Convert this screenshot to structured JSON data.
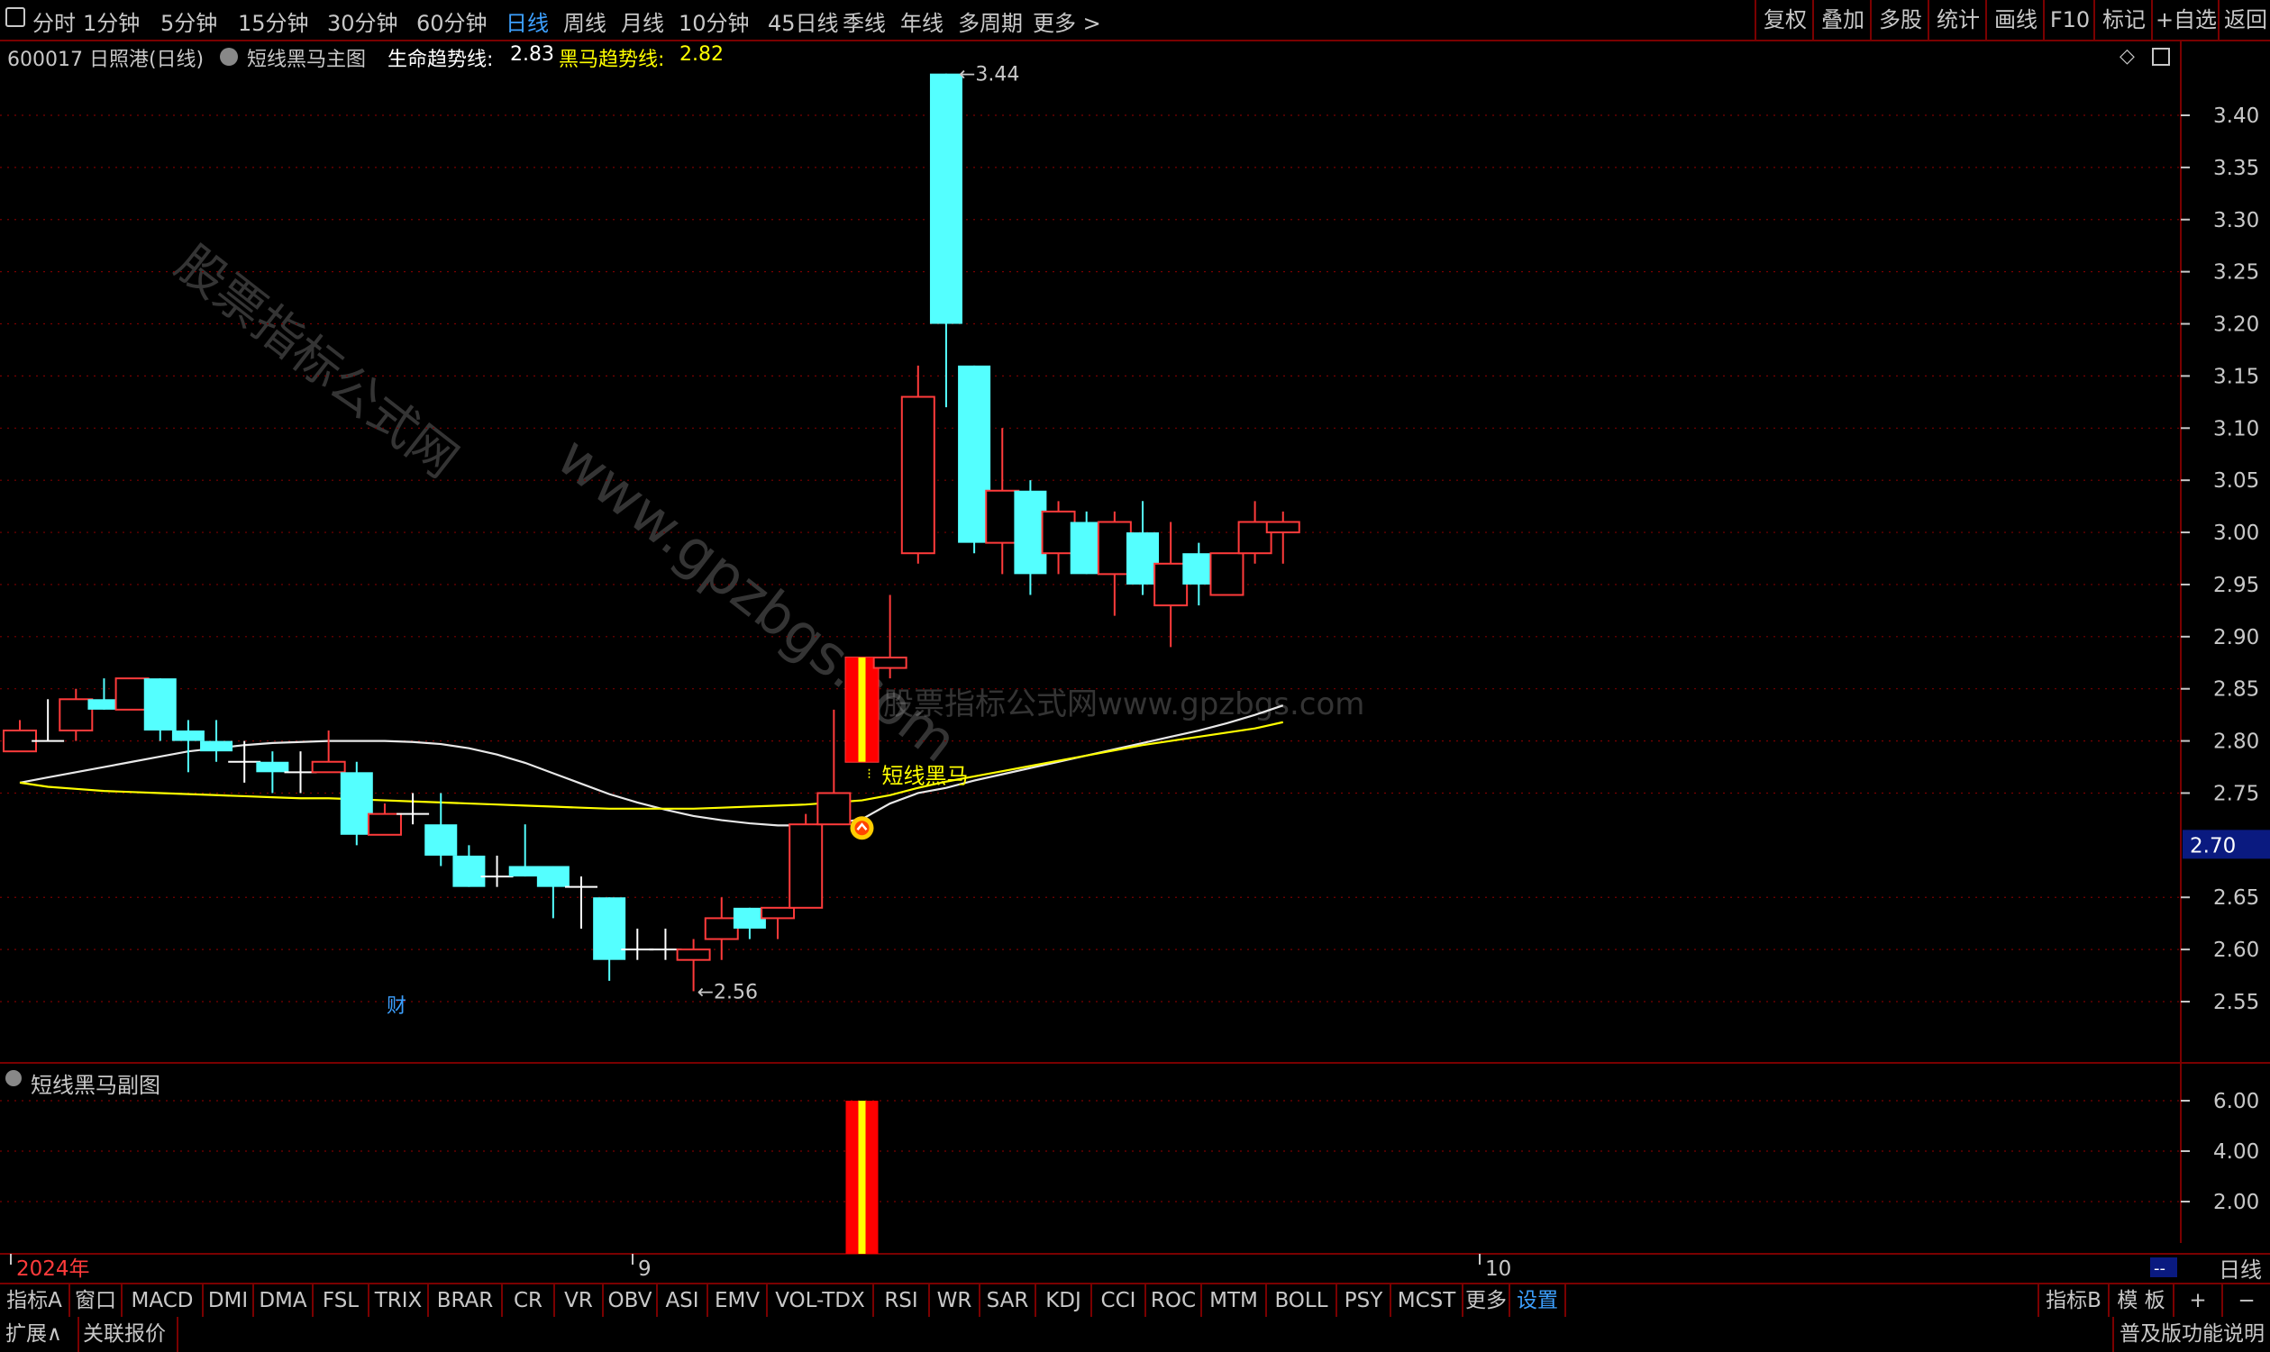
{
  "toolbar": {
    "periods": [
      "分时",
      "1分钟",
      "5分钟",
      "15分钟",
      "30分钟",
      "60分钟",
      "日线",
      "周线",
      "月线",
      "10分钟",
      "45日线",
      "季线",
      "年线",
      "多周期",
      "更多 >"
    ],
    "active_period": "日线",
    "right_buttons": [
      "复权",
      "叠加",
      "多股",
      "统计",
      "画线",
      "F10",
      "标记",
      "+自选",
      "返回"
    ]
  },
  "info": {
    "stock": "600017 日照港(日线)",
    "indicator": "短线黑马主图",
    "life_label": "生命趋势线:",
    "life_value": "2.83",
    "horse_label": "黑马趋势线:",
    "horse_value": "2.82"
  },
  "annotations": {
    "high": "3.44",
    "low": "2.56",
    "signal": "短线黑马",
    "cai": "财"
  },
  "watermarks": [
    "股票指标公式网",
    "www.gpzbgs.com",
    "股票指标公式网www.gpzbgs.com"
  ],
  "subchart": {
    "title": "短线黑马副图",
    "ticks": [
      "6.00",
      "4.00",
      "2.00"
    ]
  },
  "axis": {
    "price_ticks": [
      "3.40",
      "3.35",
      "3.30",
      "3.25",
      "3.20",
      "3.15",
      "3.10",
      "3.05",
      "3.00",
      "2.95",
      "2.90",
      "2.85",
      "2.80",
      "2.75",
      "2.65",
      "2.60",
      "2.55"
    ],
    "current_price": "2.70",
    "date_labels": [
      "2024年",
      "9",
      "10"
    ],
    "period_label": "日线",
    "scroll_marker": "--"
  },
  "tabs": [
    "指标A",
    "窗口",
    "MACD",
    "DMI",
    "DMA",
    "FSL",
    "TRIX",
    "BRAR",
    "CR",
    "VR",
    "OBV",
    "ASI",
    "EMV",
    "VOL-TDX",
    "RSI",
    "WR",
    "SAR",
    "KDJ",
    "CCI",
    "ROC",
    "MTM",
    "BOLL",
    "PSY",
    "MCST",
    "更多",
    "设置"
  ],
  "tabs_right": [
    "指标B",
    "模 板",
    "+",
    "−"
  ],
  "status": {
    "expand": "扩展∧",
    "quotes": "关联报价",
    "edition": "普及版功能说明"
  },
  "colors": {
    "up": "#ff3b3b",
    "down": "#54ffff",
    "life_line": "#e8e8e8",
    "horse_line": "#ffff00",
    "accent": "#3da0ff",
    "grid": "#7a0000"
  },
  "chart_data": {
    "type": "candlestick",
    "x_range": [
      "2024-08",
      "2024-10"
    ],
    "ylim": [
      2.52,
      3.46
    ],
    "candles": [
      {
        "o": 2.79,
        "h": 2.82,
        "l": 2.79,
        "c": 2.81
      },
      {
        "o": 2.8,
        "h": 2.84,
        "l": 2.8,
        "c": 2.8
      },
      {
        "o": 2.81,
        "h": 2.85,
        "l": 2.8,
        "c": 2.84
      },
      {
        "o": 2.84,
        "h": 2.86,
        "l": 2.83,
        "c": 2.83
      },
      {
        "o": 2.83,
        "h": 2.86,
        "l": 2.83,
        "c": 2.86
      },
      {
        "o": 2.86,
        "h": 2.86,
        "l": 2.8,
        "c": 2.81
      },
      {
        "o": 2.81,
        "h": 2.82,
        "l": 2.77,
        "c": 2.8
      },
      {
        "o": 2.8,
        "h": 2.82,
        "l": 2.78,
        "c": 2.79
      },
      {
        "o": 2.78,
        "h": 2.8,
        "l": 2.76,
        "c": 2.78
      },
      {
        "o": 2.78,
        "h": 2.79,
        "l": 2.75,
        "c": 2.77
      },
      {
        "o": 2.77,
        "h": 2.79,
        "l": 2.75,
        "c": 2.77
      },
      {
        "o": 2.77,
        "h": 2.81,
        "l": 2.77,
        "c": 2.78
      },
      {
        "o": 2.77,
        "h": 2.78,
        "l": 2.7,
        "c": 2.71
      },
      {
        "o": 2.71,
        "h": 2.74,
        "l": 2.71,
        "c": 2.73
      },
      {
        "o": 2.73,
        "h": 2.75,
        "l": 2.72,
        "c": 2.73
      },
      {
        "o": 2.72,
        "h": 2.75,
        "l": 2.68,
        "c": 2.69
      },
      {
        "o": 2.69,
        "h": 2.7,
        "l": 2.66,
        "c": 2.66
      },
      {
        "o": 2.67,
        "h": 2.69,
        "l": 2.66,
        "c": 2.67
      },
      {
        "o": 2.68,
        "h": 2.72,
        "l": 2.67,
        "c": 2.67
      },
      {
        "o": 2.68,
        "h": 2.68,
        "l": 2.63,
        "c": 2.66
      },
      {
        "o": 2.66,
        "h": 2.67,
        "l": 2.62,
        "c": 2.66
      },
      {
        "o": 2.65,
        "h": 2.65,
        "l": 2.57,
        "c": 2.59
      },
      {
        "o": 2.6,
        "h": 2.62,
        "l": 2.59,
        "c": 2.6
      },
      {
        "o": 2.6,
        "h": 2.62,
        "l": 2.59,
        "c": 2.6
      },
      {
        "o": 2.59,
        "h": 2.61,
        "l": 2.56,
        "c": 2.6
      },
      {
        "o": 2.61,
        "h": 2.65,
        "l": 2.59,
        "c": 2.63
      },
      {
        "o": 2.64,
        "h": 2.64,
        "l": 2.61,
        "c": 2.62
      },
      {
        "o": 2.63,
        "h": 2.64,
        "l": 2.61,
        "c": 2.64
      },
      {
        "o": 2.64,
        "h": 2.73,
        "l": 2.64,
        "c": 2.72
      },
      {
        "o": 2.72,
        "h": 2.83,
        "l": 2.72,
        "c": 2.75
      },
      {
        "o": 2.78,
        "h": 2.88,
        "l": 2.78,
        "c": 2.88
      },
      {
        "o": 2.87,
        "h": 2.94,
        "l": 2.86,
        "c": 2.88
      },
      {
        "o": 2.98,
        "h": 3.16,
        "l": 2.97,
        "c": 3.13
      },
      {
        "o": 3.44,
        "h": 3.44,
        "l": 3.12,
        "c": 3.2
      },
      {
        "o": 3.16,
        "h": 3.16,
        "l": 2.98,
        "c": 2.99
      },
      {
        "o": 2.99,
        "h": 3.1,
        "l": 2.96,
        "c": 3.04
      },
      {
        "o": 3.04,
        "h": 3.05,
        "l": 2.94,
        "c": 2.96
      },
      {
        "o": 2.98,
        "h": 3.03,
        "l": 2.96,
        "c": 3.02
      },
      {
        "o": 3.01,
        "h": 3.02,
        "l": 2.96,
        "c": 2.96
      },
      {
        "o": 2.96,
        "h": 3.02,
        "l": 2.92,
        "c": 3.01
      },
      {
        "o": 3.0,
        "h": 3.03,
        "l": 2.94,
        "c": 2.95
      },
      {
        "o": 2.93,
        "h": 3.01,
        "l": 2.89,
        "c": 2.97
      },
      {
        "o": 2.98,
        "h": 2.99,
        "l": 2.93,
        "c": 2.95
      },
      {
        "o": 2.94,
        "h": 2.98,
        "l": 2.94,
        "c": 2.98
      },
      {
        "o": 2.98,
        "h": 3.03,
        "l": 2.97,
        "c": 3.01
      },
      {
        "o": 3.0,
        "h": 3.02,
        "l": 2.97,
        "c": 3.01
      }
    ],
    "signal_index": 30,
    "series": [
      {
        "name": "生命趋势线",
        "values": [
          2.76,
          2.765,
          2.77,
          2.775,
          2.78,
          2.785,
          2.79,
          2.793,
          2.796,
          2.798,
          2.799,
          2.8,
          2.8,
          2.8,
          2.799,
          2.797,
          2.793,
          2.787,
          2.779,
          2.769,
          2.759,
          2.749,
          2.741,
          2.734,
          2.728,
          2.724,
          2.721,
          2.719,
          2.719,
          2.721,
          2.725,
          2.74,
          2.75,
          2.755,
          2.762,
          2.768,
          2.774,
          2.78,
          2.786,
          2.792,
          2.798,
          2.804,
          2.81,
          2.817,
          2.825,
          2.834
        ]
      },
      {
        "name": "黑马趋势线",
        "values": [
          2.76,
          2.756,
          2.754,
          2.752,
          2.751,
          2.75,
          2.749,
          2.748,
          2.747,
          2.746,
          2.745,
          2.745,
          2.744,
          2.743,
          2.742,
          2.741,
          2.74,
          2.739,
          2.738,
          2.737,
          2.736,
          2.735,
          2.735,
          2.735,
          2.735,
          2.736,
          2.737,
          2.738,
          2.739,
          2.741,
          2.743,
          2.748,
          2.755,
          2.761,
          2.766,
          2.771,
          2.776,
          2.781,
          2.786,
          2.791,
          2.796,
          2.8,
          2.804,
          2.808,
          2.812,
          2.818
        ]
      }
    ],
    "sub_bars": [
      {
        "index": 30,
        "value": 6.0
      }
    ],
    "sub_ylim": [
      0,
      7.5
    ]
  }
}
